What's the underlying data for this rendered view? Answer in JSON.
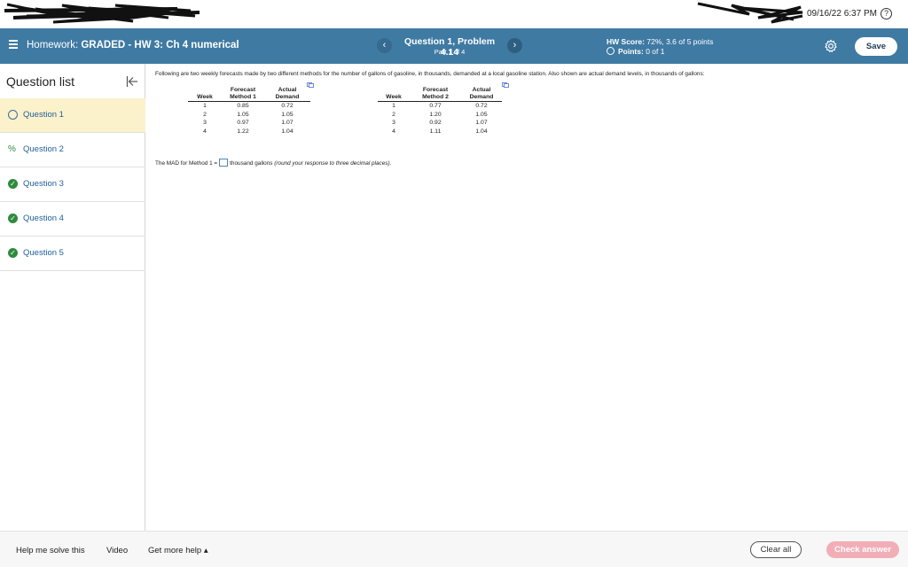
{
  "topbar": {
    "datetime": "09/16/22 6:37 PM",
    "help_glyph": "?"
  },
  "header": {
    "menu_icon": "menu-icon",
    "homework_prefix": "Homework: ",
    "homework_title": "GRADED - HW 3: Ch 4 numerical",
    "question_title": "Question 1, Problem 4.14",
    "question_part": "Part 1 of 4",
    "prev_glyph": "‹",
    "next_glyph": "›",
    "hw_score_label": "HW Score:",
    "hw_score_value": "72%, 3.6 of 5 points",
    "points_label": "Points:",
    "points_value": "0 of 1",
    "save_label": "Save",
    "colors": {
      "bar": "#3f7aa3"
    }
  },
  "sidebar": {
    "title": "Question list",
    "items": [
      {
        "label": "Question 1",
        "status": "open",
        "active": true
      },
      {
        "label": "Question 2",
        "status": "partial",
        "active": false
      },
      {
        "label": "Question 3",
        "status": "done",
        "active": false
      },
      {
        "label": "Question 4",
        "status": "done",
        "active": false
      },
      {
        "label": "Question 5",
        "status": "done",
        "active": false
      }
    ]
  },
  "problem": {
    "prompt": "Following are two weekly forecasts made by two different methods for the number of gallons of gasoline, in thousands, demanded at a local gasoline station. Also shown are actual demand levels, in thousands of gallons:",
    "table1": {
      "headers": [
        "Week",
        "Forecast Method 1",
        "Actual Demand"
      ],
      "rows": [
        [
          "1",
          "0.85",
          "0.72"
        ],
        [
          "2",
          "1.05",
          "1.05"
        ],
        [
          "3",
          "0.97",
          "1.07"
        ],
        [
          "4",
          "1.22",
          "1.04"
        ]
      ]
    },
    "table2": {
      "headers": [
        "Week",
        "Forecast Method 2",
        "Actual Demand"
      ],
      "rows": [
        [
          "1",
          "0.77",
          "0.72"
        ],
        [
          "2",
          "1.20",
          "1.05"
        ],
        [
          "3",
          "0.92",
          "1.07"
        ],
        [
          "4",
          "1.11",
          "1.04"
        ]
      ]
    },
    "mad_prefix": "The MAD for Method 1 =",
    "mad_suffix": "thousand gallons",
    "mad_hint": "(round your response to three decimal places)."
  },
  "footer": {
    "help_me_solve": "Help me solve this",
    "video": "Video",
    "get_more_help": "Get more help ▴",
    "clear_all": "Clear all",
    "check_answer": "Check answer"
  }
}
